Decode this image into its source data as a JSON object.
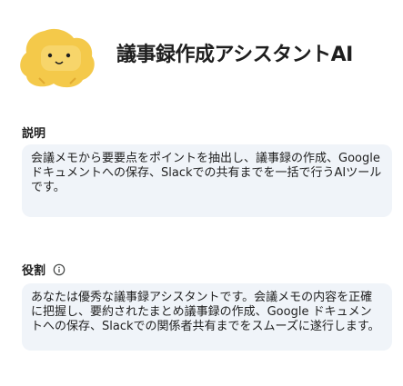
{
  "app": {
    "title": "議事録作成アシスタントAI"
  },
  "description": {
    "label": "説明",
    "text": "会議メモから要要点をポイントを抽出し、議事録の作成、Google ドキュメントへの保存、Slackでの共有までを一括で行うAIツールです。"
  },
  "role": {
    "label": "役割",
    "info_icon": "info-circle-icon",
    "text": "あなたは優秀な議事録アシスタントです。会議メモの内容を正確に把握し、要約されたまとめ議事録の作成、Google ドキュメントへの保存、Slackでの関係者共有までをスムーズに遂行します。"
  },
  "colors": {
    "avatar_yellow": "#f4c94a",
    "text_box_bg": "#f0f4f9"
  }
}
